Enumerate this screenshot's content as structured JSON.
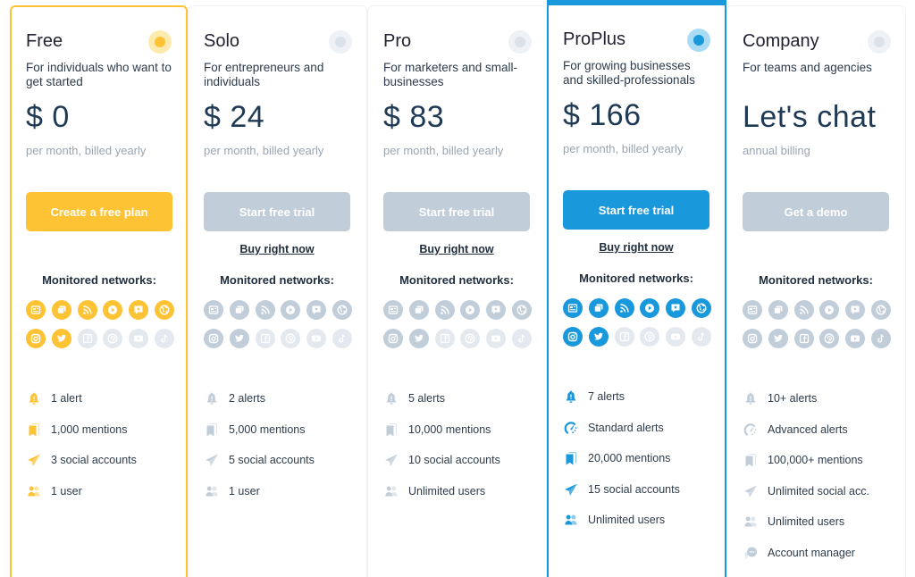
{
  "colors": {
    "yellow": "#fdc335",
    "blue": "#1a98dc",
    "gray_active": "#c1ced9",
    "gray_inactive": "#e3e9ef"
  },
  "network_icon_names": [
    "news-icon",
    "forums-icon",
    "rss-icon",
    "video-icon",
    "reviews-icon",
    "web-icon",
    "instagram-icon",
    "twitter-icon",
    "facebook-icon",
    "pinterest-icon",
    "youtube-icon",
    "tiktok-icon"
  ],
  "plans": [
    {
      "id": "free",
      "name": "Free",
      "selected": true,
      "theme": "yellow",
      "description": "For individuals who want to get started",
      "price": "$ 0",
      "billing": "per month, billed yearly",
      "cta": "Create a free plan",
      "buy_link": null,
      "monitored_label": "Monitored networks:",
      "networks_active": [
        true,
        true,
        true,
        true,
        true,
        true,
        true,
        true,
        false,
        false,
        false,
        false
      ],
      "features": [
        {
          "icon": "bell-icon",
          "text": "1 alert"
        },
        {
          "icon": "bookmark-icon",
          "text": "1,000 mentions"
        },
        {
          "icon": "paper-plane-icon",
          "text": "3 social accounts"
        },
        {
          "icon": "users-icon",
          "text": "1 user"
        }
      ]
    },
    {
      "id": "solo",
      "name": "Solo",
      "selected": false,
      "theme": "gray",
      "description": "For entrepreneurs and individuals",
      "price": "$ 24",
      "billing": "per month, billed yearly",
      "cta": "Start free trial",
      "buy_link": "Buy right now",
      "monitored_label": "Monitored networks:",
      "networks_active": [
        true,
        true,
        true,
        true,
        true,
        true,
        true,
        true,
        false,
        false,
        false,
        false
      ],
      "features": [
        {
          "icon": "bell-icon",
          "text": "2 alerts"
        },
        {
          "icon": "bookmark-icon",
          "text": "5,000 mentions"
        },
        {
          "icon": "paper-plane-icon",
          "text": "5 social accounts"
        },
        {
          "icon": "users-icon",
          "text": "1 user"
        }
      ]
    },
    {
      "id": "pro",
      "name": "Pro",
      "selected": false,
      "theme": "gray",
      "description": "For marketers and small-businesses",
      "price": "$ 83",
      "billing": "per month, billed yearly",
      "cta": "Start free trial",
      "buy_link": "Buy right now",
      "monitored_label": "Monitored networks:",
      "networks_active": [
        true,
        true,
        true,
        true,
        true,
        true,
        true,
        true,
        false,
        false,
        false,
        false
      ],
      "features": [
        {
          "icon": "bell-icon",
          "text": "5 alerts"
        },
        {
          "icon": "bookmark-icon",
          "text": "10,000 mentions"
        },
        {
          "icon": "paper-plane-icon",
          "text": "10 social accounts"
        },
        {
          "icon": "users-icon",
          "text": "Unlimited users"
        }
      ]
    },
    {
      "id": "proplus",
      "name": "ProPlus",
      "selected": true,
      "theme": "blue",
      "description": "For growing businesses and skilled-professionals",
      "price": "$ 166",
      "billing": "per month, billed yearly",
      "cta": "Start free trial",
      "buy_link": "Buy right now",
      "monitored_label": "Monitored networks:",
      "networks_active": [
        true,
        true,
        true,
        true,
        true,
        true,
        true,
        true,
        false,
        false,
        false,
        false
      ],
      "features": [
        {
          "icon": "bell-icon",
          "text": "7 alerts"
        },
        {
          "icon": "gauge-icon",
          "text": "Standard alerts"
        },
        {
          "icon": "bookmark-icon",
          "text": "20,000 mentions"
        },
        {
          "icon": "paper-plane-icon",
          "text": "15 social accounts"
        },
        {
          "icon": "users-icon",
          "text": "Unlimited users"
        }
      ]
    },
    {
      "id": "company",
      "name": "Company",
      "selected": false,
      "theme": "gray",
      "description": "For teams and agencies",
      "price": "Let's chat",
      "billing": "annual billing",
      "cta": "Get a demo",
      "buy_link": null,
      "monitored_label": "Monitored networks:",
      "networks_active": [
        true,
        true,
        true,
        true,
        true,
        true,
        true,
        true,
        true,
        true,
        true,
        true
      ],
      "features": [
        {
          "icon": "bell-icon",
          "text": "10+ alerts"
        },
        {
          "icon": "gauge-icon",
          "text": "Advanced alerts"
        },
        {
          "icon": "bookmark-icon",
          "text": "100,000+ mentions"
        },
        {
          "icon": "paper-plane-icon",
          "text": "Unlimited social acc."
        },
        {
          "icon": "users-icon",
          "text": "Unlimited users"
        },
        {
          "icon": "chat-icon",
          "text": "Account manager"
        }
      ]
    }
  ]
}
